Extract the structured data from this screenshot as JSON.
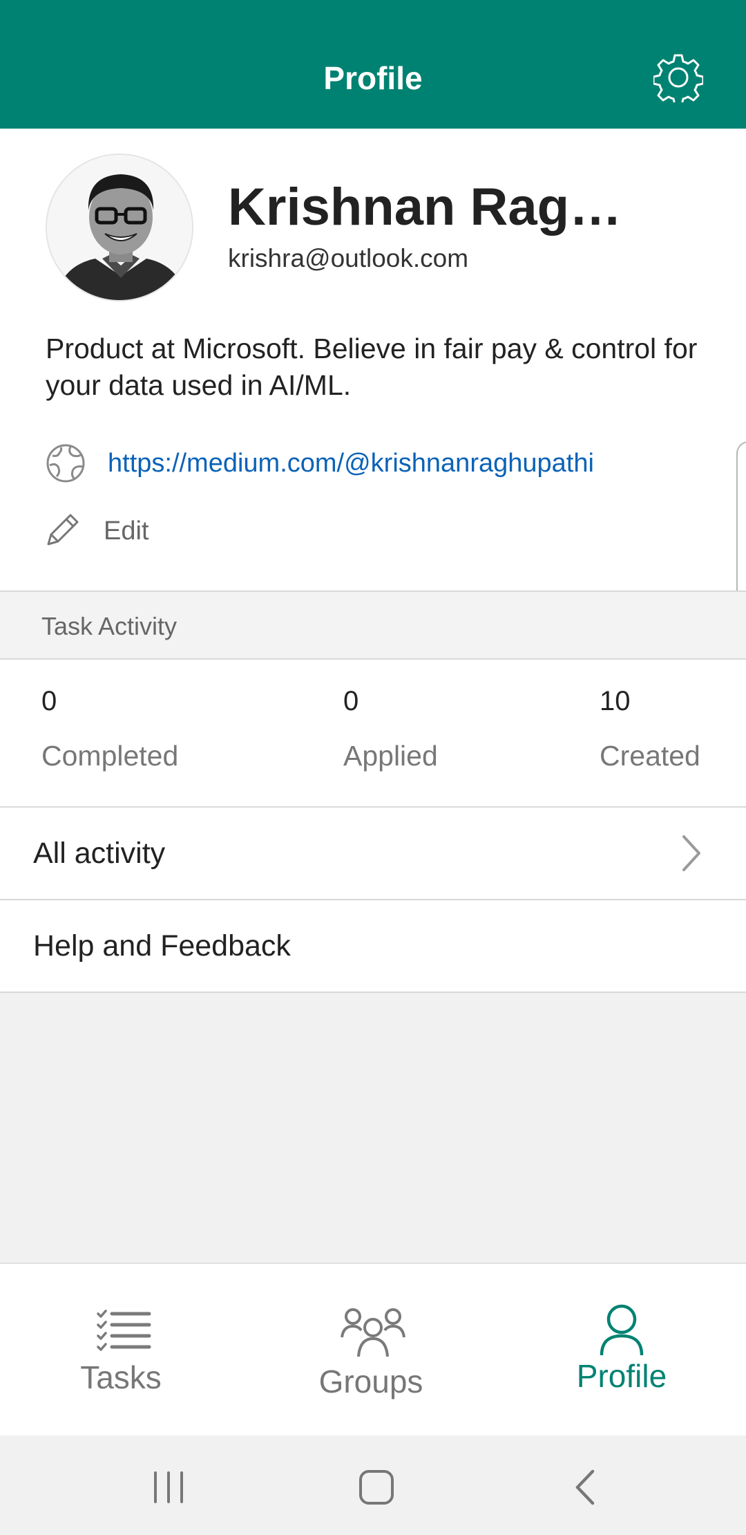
{
  "header": {
    "title": "Profile",
    "settings_icon": "gear-icon",
    "background_color": "#008272"
  },
  "profile": {
    "name": "Krishnan Raghu…",
    "email": "krishra@outlook.com",
    "bio": "Product at Microsoft. Believe in fair pay & control for your data used in AI/ML.",
    "website_icon": "globe-icon",
    "website": "https://medium.com/@krishnanraghupathi",
    "edit_icon": "pencil-icon",
    "edit_label": "Edit"
  },
  "task_activity": {
    "header": "Task Activity",
    "stats": [
      {
        "value": "0",
        "label": "Completed"
      },
      {
        "value": "0",
        "label": "Applied"
      },
      {
        "value": "10",
        "label": "Created"
      }
    ]
  },
  "menu": {
    "all_activity": "All activity",
    "help_feedback": "Help and Feedback"
  },
  "bottom_nav": {
    "items": [
      {
        "label": "Tasks",
        "icon": "checklist-icon",
        "active": false
      },
      {
        "label": "Groups",
        "icon": "people-icon",
        "active": false
      },
      {
        "label": "Profile",
        "icon": "person-icon",
        "active": true
      }
    ],
    "active_color": "#008272",
    "inactive_color": "#777777"
  },
  "system_nav": {
    "recents_icon": "recent-apps-icon",
    "home_icon": "home-icon",
    "back_icon": "back-icon"
  }
}
